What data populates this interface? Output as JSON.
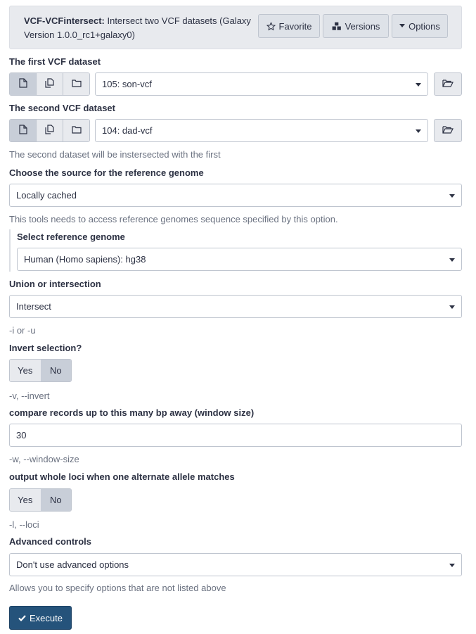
{
  "header": {
    "tool_name": "VCF-VCFintersect:",
    "tool_description": " Intersect two VCF datasets (Galaxy Version 1.0.0_rc1+galaxy0)",
    "favorite_label": "Favorite",
    "versions_label": "Versions",
    "options_label": "Options"
  },
  "first_vcf": {
    "label": "The first VCF dataset",
    "value": "105: son-vcf"
  },
  "second_vcf": {
    "label": "The second VCF dataset",
    "value": "104: dad-vcf",
    "help": "The second dataset will be instersected with the first"
  },
  "ref_source": {
    "label": "Choose the source for the reference genome",
    "value": "Locally cached",
    "help": "This tools needs to access reference genomes sequence specified by this option."
  },
  "ref_genome": {
    "label": "Select reference genome",
    "value": "Human (Homo sapiens): hg38"
  },
  "union_intersection": {
    "label": "Union or intersection",
    "value": "Intersect",
    "help": "-i or -u"
  },
  "invert": {
    "label": "Invert selection?",
    "yes": "Yes",
    "no": "No",
    "help": "-v, --invert"
  },
  "window": {
    "label": "compare records up to this many bp away (window size)",
    "value": "30",
    "help": "-w, --window-size"
  },
  "loci": {
    "label": "output whole loci when one alternate allele matches",
    "yes": "Yes",
    "no": "No",
    "help": "-l, --loci"
  },
  "advanced": {
    "label": "Advanced controls",
    "value": "Don't use advanced options",
    "help": "Allows you to specify options that are not listed above"
  },
  "execute_label": "Execute"
}
